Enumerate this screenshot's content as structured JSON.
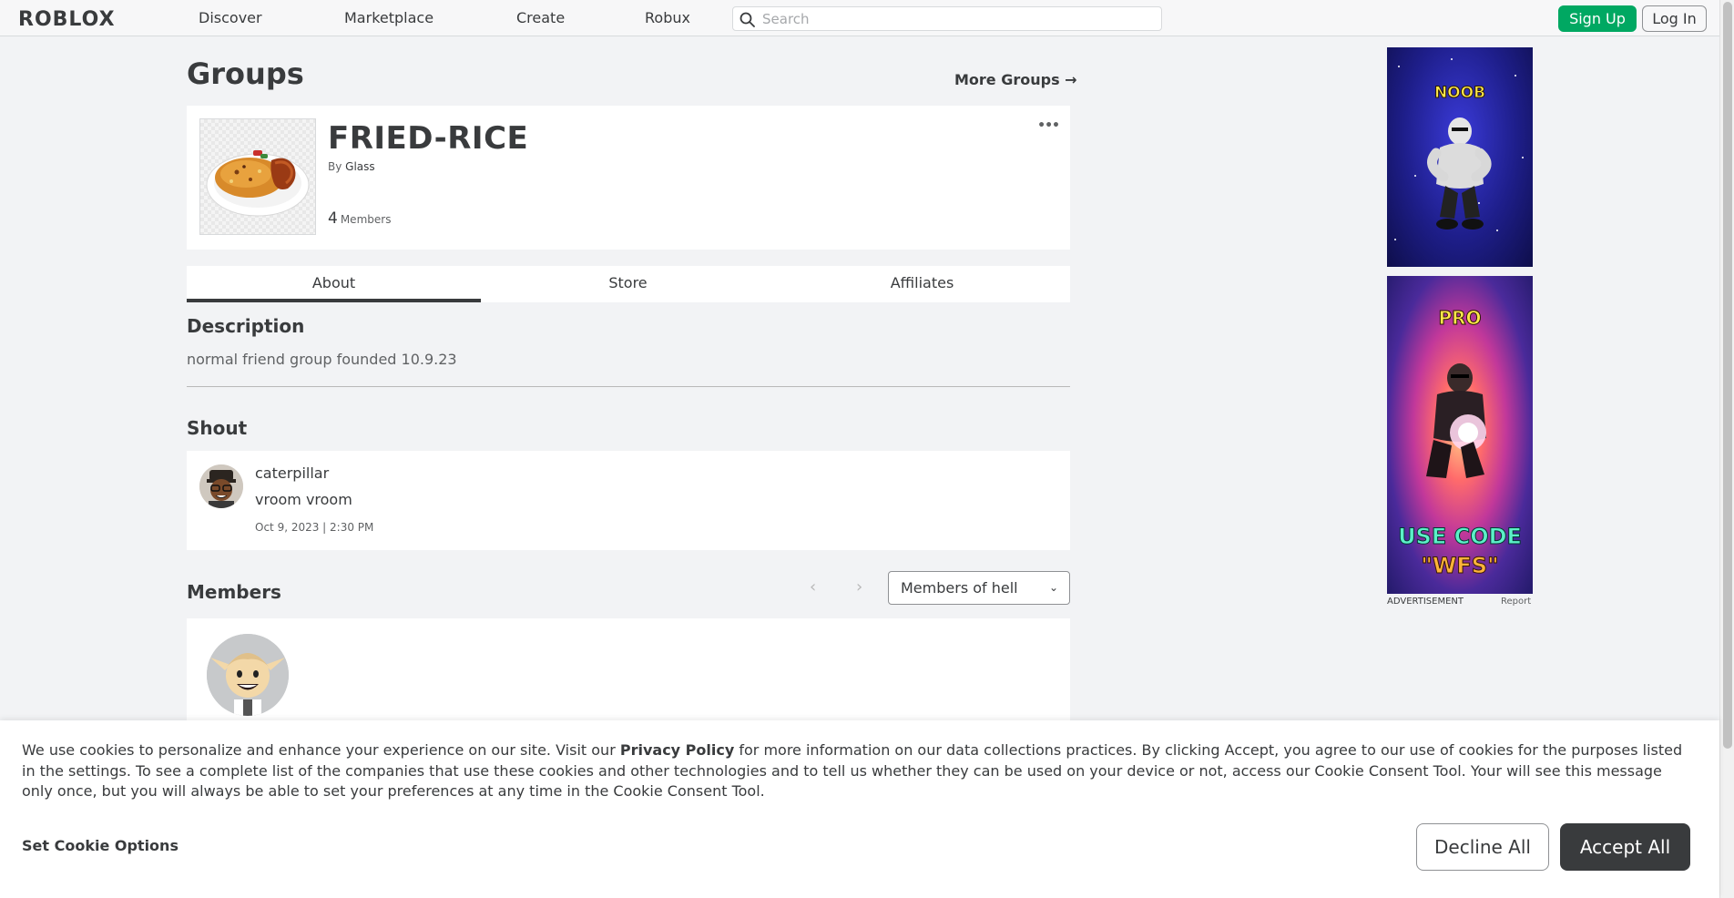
{
  "nav": {
    "logo": "ROBLOX",
    "links": [
      "Discover",
      "Marketplace",
      "Create",
      "Robux"
    ],
    "search_placeholder": "Search",
    "signup_label": "Sign Up",
    "login_label": "Log In"
  },
  "page": {
    "title": "Groups",
    "more_groups_label": "More Groups →"
  },
  "group": {
    "name": "FRIED-RICE",
    "by_prefix": "By",
    "owner": "Glass",
    "member_count": "4",
    "members_label": "Members",
    "more_menu": "•••"
  },
  "tabs": [
    {
      "label": "About",
      "active": true
    },
    {
      "label": "Store",
      "active": false
    },
    {
      "label": "Affiliates",
      "active": false
    }
  ],
  "about": {
    "description_title": "Description",
    "description_text": "normal friend group founded 10.9.23",
    "shout_title": "Shout",
    "shout": {
      "user": "caterpillar",
      "body": "vroom vroom",
      "timestamp": "Oct 9, 2023 | 2:30 PM"
    },
    "members_title": "Members",
    "role_select_value": "Members of hell"
  },
  "ads": {
    "ad1_text": "NOOB",
    "ad2_top_text": "PRO",
    "ad2_bottom_text_1": "USE CODE",
    "ad2_bottom_text_2": "\"WFS\"",
    "label": "ADVERTISEMENT",
    "report": "Report"
  },
  "cookie": {
    "text_before_link": "We use cookies to personalize and enhance your experience on our site. Visit our ",
    "link_text": "Privacy Policy",
    "text_after_link": " for more information on our data collections practices. By clicking Accept, you agree to our use of cookies for the purposes listed in the settings. To see a complete list of the companies that use these cookies and other technologies and to tell us whether they can be used on your device or not, access our Cookie Consent Tool. Your will see this message only once, but you will always be able to set your preferences at any time in the Cookie Consent Tool.",
    "options_label": "Set Cookie Options",
    "decline_label": "Decline All",
    "accept_label": "Accept All"
  },
  "colors": {
    "signup_green": "#00a862",
    "text_dark": "#393b3d",
    "page_bg": "#f2f3f5"
  }
}
